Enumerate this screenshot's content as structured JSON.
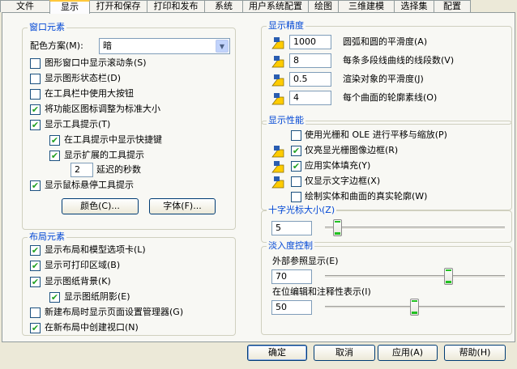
{
  "tabs": [
    "文件",
    "显示",
    "打开和保存",
    "打印和发布",
    "系统",
    "用户系统配置",
    "绘图",
    "三维建模",
    "选择集",
    "配置"
  ],
  "window_elements": {
    "title": "窗口元素",
    "color_scheme_label": "配色方案(M):",
    "color_scheme_value": "暗",
    "show_scrollbars": "图形窗口中显示滚动条(S)",
    "show_statusbar": "显示图形状态栏(D)",
    "large_buttons": "在工具栏中使用大按钮",
    "ribbon_icons": "将功能区图标调整为标准大小",
    "show_tooltips": "显示工具提示(T)",
    "tooltip_shortcut": "在工具提示中显示快捷键",
    "extended_tooltips": "显示扩展的工具提示",
    "delay_value": "2",
    "delay_label": "延迟的秒数",
    "rollover_tooltips": "显示鼠标悬停工具提示",
    "colors_button": "颜色(C)...",
    "fonts_button": "字体(F)..."
  },
  "layout_elements": {
    "title": "布局元素",
    "layout_model_tabs": "显示布局和模型选项卡(L)",
    "printable_area": "显示可打印区域(B)",
    "paper_background": "显示图纸背景(K)",
    "paper_shadow": "显示图纸阴影(E)",
    "page_setup_manager": "新建布局时显示页面设置管理器(G)",
    "create_viewport": "在新布局中创建视口(N)"
  },
  "display_resolution": {
    "title": "显示精度",
    "arc_smoothness_value": "1000",
    "arc_smoothness_label": "圆弧和圆的平滑度(A)",
    "polyline_segments_value": "8",
    "polyline_segments_label": "每条多段线曲线的线段数(V)",
    "render_smoothness_value": "0.5",
    "render_smoothness_label": "渲染对象的平滑度(J)",
    "contour_lines_value": "4",
    "contour_lines_label": "每个曲面的轮廓素线(O)"
  },
  "display_performance": {
    "title": "显示性能",
    "raster_ole": "使用光栅和 OLE 进行平移与缩放(P)",
    "highlight_raster": "仅亮显光栅图像边框(R)",
    "solid_fill": "应用实体填充(Y)",
    "text_frame": "仅显示文字边框(X)",
    "true_silhouettes": "绘制实体和曲面的真实轮廓(W)"
  },
  "crosshair": {
    "title": "十字光标大小(Z)",
    "value": "5",
    "fraction": 0.05
  },
  "fade_control": {
    "title": "淡入度控制",
    "xref_label": "外部参照显示(E)",
    "xref_value": "70",
    "xref_fraction": 0.7,
    "inplace_label": "在位编辑和注释性表示(I)",
    "inplace_value": "50",
    "inplace_fraction": 0.5
  },
  "footer": {
    "ok": "确定",
    "cancel": "取消",
    "apply": "应用(A)",
    "help": "帮助(H)"
  },
  "colors": {
    "accent": "#0046d5",
    "check": "#21a121",
    "active_tab": "#ffc83c"
  }
}
